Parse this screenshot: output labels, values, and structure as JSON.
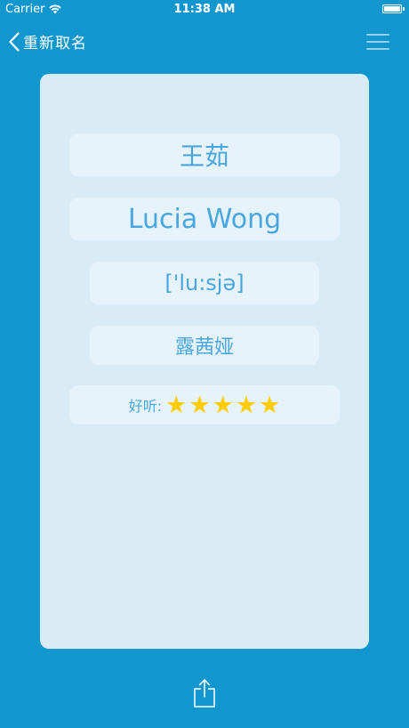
{
  "status_bar": {
    "carrier": "Carrier",
    "time": "11:38 AM"
  },
  "nav": {
    "back_label": "重新取名"
  },
  "card": {
    "chinese_name": "王茹",
    "english_name": "Lucia Wong",
    "pronunciation": "['lu:sjə]",
    "transliteration": "露茜娅",
    "rating": {
      "label": "好听:",
      "stars": 5,
      "max_stars": 5
    }
  },
  "colors": {
    "background": "#1196cd",
    "card": "#d9ecf6",
    "pill": "#e6f3fa",
    "text_accent": "#4aa6e0",
    "star": "#ffcc00"
  },
  "icons": {
    "back": "chevron-left-icon",
    "menu": "hamburger-menu-icon",
    "share": "share-icon",
    "wifi": "wifi-icon",
    "battery": "battery-icon",
    "star": "star-icon"
  }
}
